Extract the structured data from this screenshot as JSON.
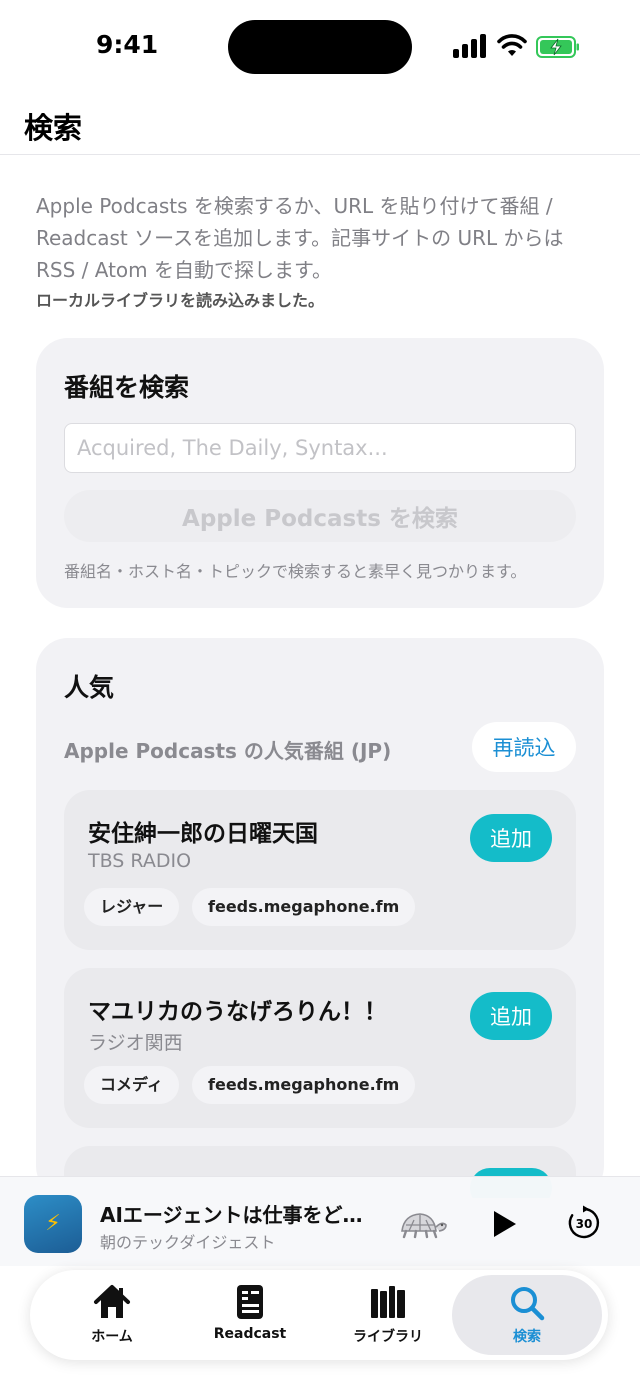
{
  "status_bar": {
    "time": "9:41"
  },
  "header": {
    "title": "検索"
  },
  "intro": "Apple Podcasts を検索するか、URL を貼り付けて番組 / Readcast ソースを追加します。記事サイトの URL からは RSS / Atom を自動で探します。",
  "status_message": "ローカルライブラリを読み込みました。",
  "search_card": {
    "title": "番組を検索",
    "input_value": "",
    "placeholder": "Acquired, The Daily, Syntax...",
    "button_label": "Apple Podcasts を検索",
    "hint": "番組名・ホスト名・トピックで検索すると素早く見つかります。"
  },
  "popular": {
    "title": "人気",
    "subtitle": "Apple Podcasts の人気番組 (JP)",
    "reload_label": "再読込",
    "items": [
      {
        "title": "安住紳一郎の日曜天国",
        "subtitle": "TBS RADIO",
        "tags": [
          "レジャー",
          "feeds.megaphone.fm"
        ],
        "add_label": "追加"
      },
      {
        "title": "マユリカのうなげろりん！！",
        "subtitle": "ラジオ関西",
        "tags": [
          "コメディ",
          "feeds.megaphone.fm"
        ],
        "add_label": "追加"
      }
    ]
  },
  "player": {
    "title": "AIエージェントは仕事をど…",
    "subtitle": "朝のテックダイジェスト",
    "skip_seconds": "30",
    "artwork_icon": "lightning-bolt-icon"
  },
  "tabs": [
    {
      "label": "ホーム",
      "icon": "house-icon"
    },
    {
      "label": "Readcast",
      "icon": "document-icon"
    },
    {
      "label": "ライブラリ",
      "icon": "books-icon"
    },
    {
      "label": "検索",
      "icon": "magnifier-icon",
      "active": true
    }
  ],
  "colors": {
    "accent": "#1b8fd4",
    "add_button": "#14bcc9",
    "card_bg": "#f2f2f5"
  }
}
